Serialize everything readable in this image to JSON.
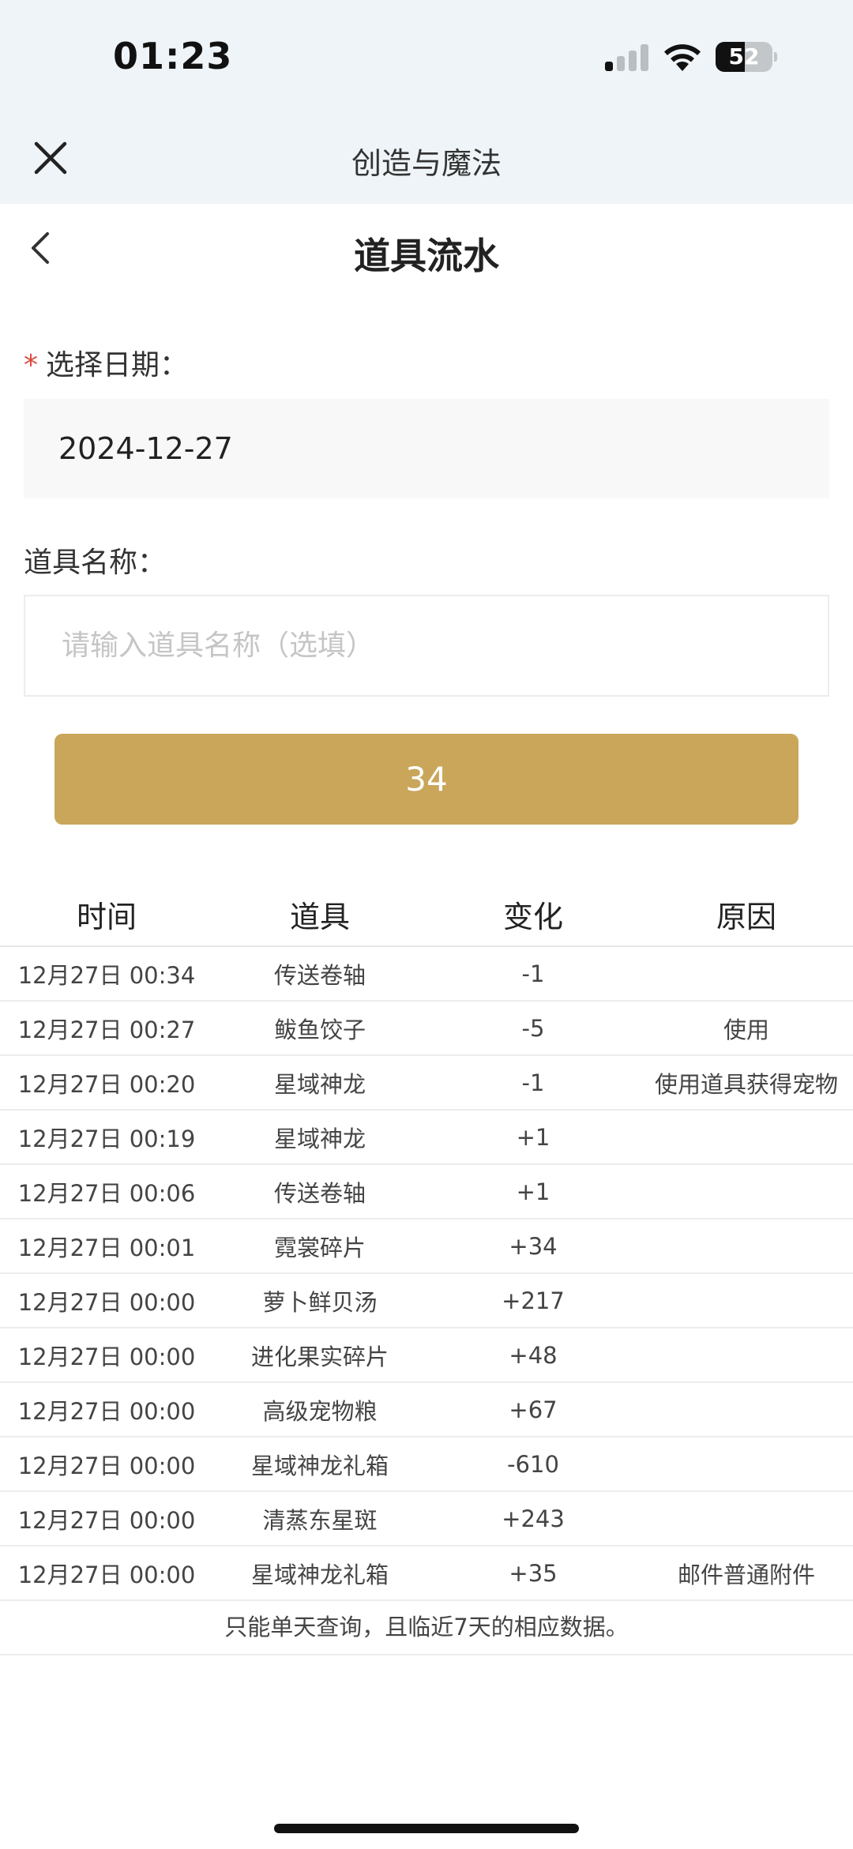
{
  "status_bar": {
    "time": "01:23",
    "battery_level": "52",
    "battery_fraction": 0.52,
    "signal_bars_active": 1
  },
  "app_bar": {
    "title": "创造与魔法",
    "close_icon": "close-icon"
  },
  "page": {
    "title": "道具流水",
    "back_icon": "chevron-left-icon"
  },
  "form": {
    "date_required_mark": "*",
    "date_label": "选择日期：",
    "date_value": "2024-12-27",
    "item_label": "道具名称：",
    "item_placeholder": "请输入道具名称（选填）",
    "item_value": "",
    "query_button_label": "34"
  },
  "table": {
    "headers": [
      "时间",
      "道具",
      "变化",
      "原因"
    ],
    "rows": [
      {
        "time": "12月27日 00:34",
        "item": "传送卷轴",
        "change": "-1",
        "reason": ""
      },
      {
        "time": "12月27日 00:27",
        "item": "鲅鱼饺子",
        "change": "-5",
        "reason": "使用"
      },
      {
        "time": "12月27日 00:20",
        "item": "星域神龙",
        "change": "-1",
        "reason": "使用道具获得宠物"
      },
      {
        "time": "12月27日 00:19",
        "item": "星域神龙",
        "change": "+1",
        "reason": ""
      },
      {
        "time": "12月27日 00:06",
        "item": "传送卷轴",
        "change": "+1",
        "reason": ""
      },
      {
        "time": "12月27日 00:01",
        "item": "霓裳碎片",
        "change": "+34",
        "reason": ""
      },
      {
        "time": "12月27日 00:00",
        "item": "萝卜鲜贝汤",
        "change": "+217",
        "reason": ""
      },
      {
        "time": "12月27日 00:00",
        "item": "进化果实碎片",
        "change": "+48",
        "reason": ""
      },
      {
        "time": "12月27日 00:00",
        "item": "高级宠物粮",
        "change": "+67",
        "reason": ""
      },
      {
        "time": "12月27日 00:00",
        "item": "星域神龙礼箱",
        "change": "-610",
        "reason": ""
      },
      {
        "time": "12月27日 00:00",
        "item": "清蒸东星斑",
        "change": "+243",
        "reason": ""
      },
      {
        "time": "12月27日 00:00",
        "item": "星域神龙礼箱",
        "change": "+35",
        "reason": "邮件普通附件"
      }
    ],
    "footer_note": "只能单天查询，且临近7天的相应数据。"
  },
  "colors": {
    "header_bg": "#eef4f7",
    "accent_button": "#c9a65a",
    "required": "#e0483d"
  }
}
